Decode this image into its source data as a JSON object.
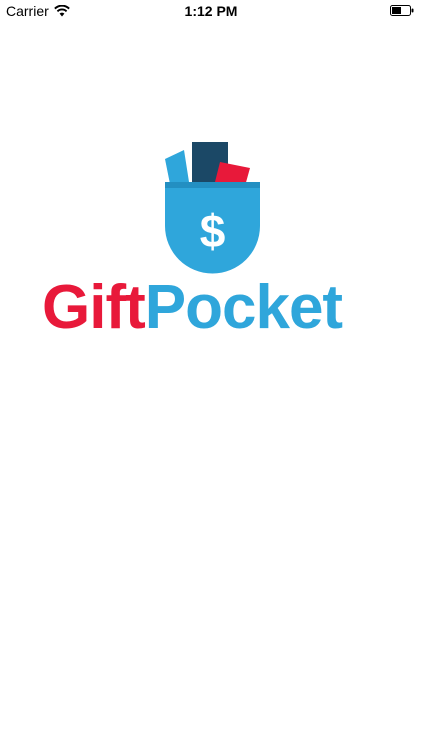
{
  "status_bar": {
    "carrier": "Carrier",
    "time": "1:12 PM",
    "wifi_icon": "wifi-icon",
    "battery_icon": "battery-icon"
  },
  "logo": {
    "word_part1": "Gift",
    "word_part2": "Pocket",
    "icon": "wallet-dollar-icon",
    "colors": {
      "red": "#E8193A",
      "blue": "#2FA6DB",
      "navy": "#1B4866"
    }
  }
}
